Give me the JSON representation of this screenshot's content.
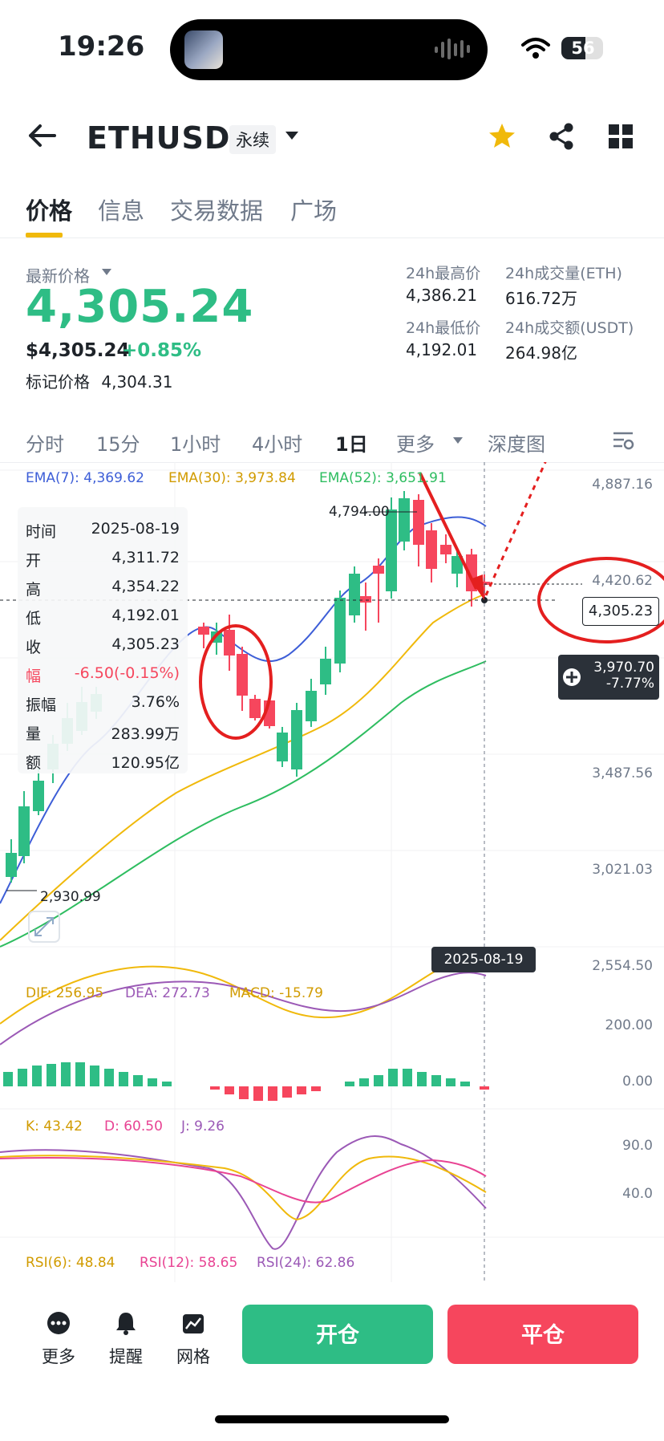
{
  "status": {
    "time": "19:26",
    "battery": "56"
  },
  "header": {
    "symbol": "ETHUSDT",
    "contract_type": "永续"
  },
  "tabs": [
    "价格",
    "信息",
    "交易数据",
    "广场"
  ],
  "price": {
    "last_label": "最新价格",
    "last": "4,305.24",
    "usd": "$4,305.24",
    "change": "+0.85%",
    "mark_label": "标记价格",
    "mark": "4,304.31"
  },
  "stats": {
    "high_label": "24h最高价",
    "high": "4,386.21",
    "low_label": "24h最低价",
    "low": "4,192.01",
    "vol_label": "24h成交量(ETH)",
    "vol": "616.72万",
    "amt_label": "24h成交额(USDT)",
    "amt": "264.98亿"
  },
  "intervals": [
    "分时",
    "15分",
    "1小时",
    "4小时",
    "1日",
    "更多",
    "深度图"
  ],
  "active_interval": "1日",
  "ema": {
    "ema7": "EMA(7): 4,369.62",
    "ema30": "EMA(30): 3,973.84",
    "ema52": "EMA(52): 3,651.91"
  },
  "price_axis": [
    "4,887.16",
    "4,420.62",
    "3,487.56",
    "3,021.03",
    "2,554.50"
  ],
  "chart_labels": {
    "high_mark": "4,794.00",
    "low_mark": "2,930.99"
  },
  "tooltip": {
    "rows": [
      {
        "label": "时间",
        "value": "2025-08-19"
      },
      {
        "label": "开",
        "value": "4,311.72"
      },
      {
        "label": "高",
        "value": "4,354.22"
      },
      {
        "label": "低",
        "value": "4,192.01"
      },
      {
        "label": "收",
        "value": "4,305.23"
      },
      {
        "label": "幅",
        "value": "-6.50(-0.15%)"
      },
      {
        "label": "振幅",
        "value": "3.76%"
      },
      {
        "label": "量",
        "value": "283.99万"
      },
      {
        "label": "额",
        "value": "120.95亿"
      }
    ]
  },
  "last_price_tag": "4,305.23",
  "cross_tag": {
    "price": "3,970.70",
    "pct": "-7.77%"
  },
  "date_tag": "2025-08-19",
  "macd": {
    "dif": "DIF: 256.95",
    "dea": "DEA: 272.73",
    "macd": "MACD: -15.79",
    "axis": [
      "200.00",
      "0.00"
    ]
  },
  "kdj": {
    "k": "K: 43.42",
    "d": "D: 60.50",
    "j": "J: 9.26",
    "axis": [
      "90.0",
      "40.0"
    ]
  },
  "rsi": {
    "rsi6": "RSI(6): 48.84",
    "rsi12": "RSI(12): 58.65",
    "rsi24": "RSI(24): 62.86"
  },
  "bottom": {
    "more": "更多",
    "alert": "提醒",
    "grid": "网格",
    "open": "开仓",
    "close": "平仓"
  },
  "colors": {
    "up": "#2ebd85",
    "down": "#f6465d",
    "accent": "#f0b90b",
    "ema7": "#3d5ed7",
    "ema30": "#f0b90b",
    "ema52": "#2ebd60"
  }
}
